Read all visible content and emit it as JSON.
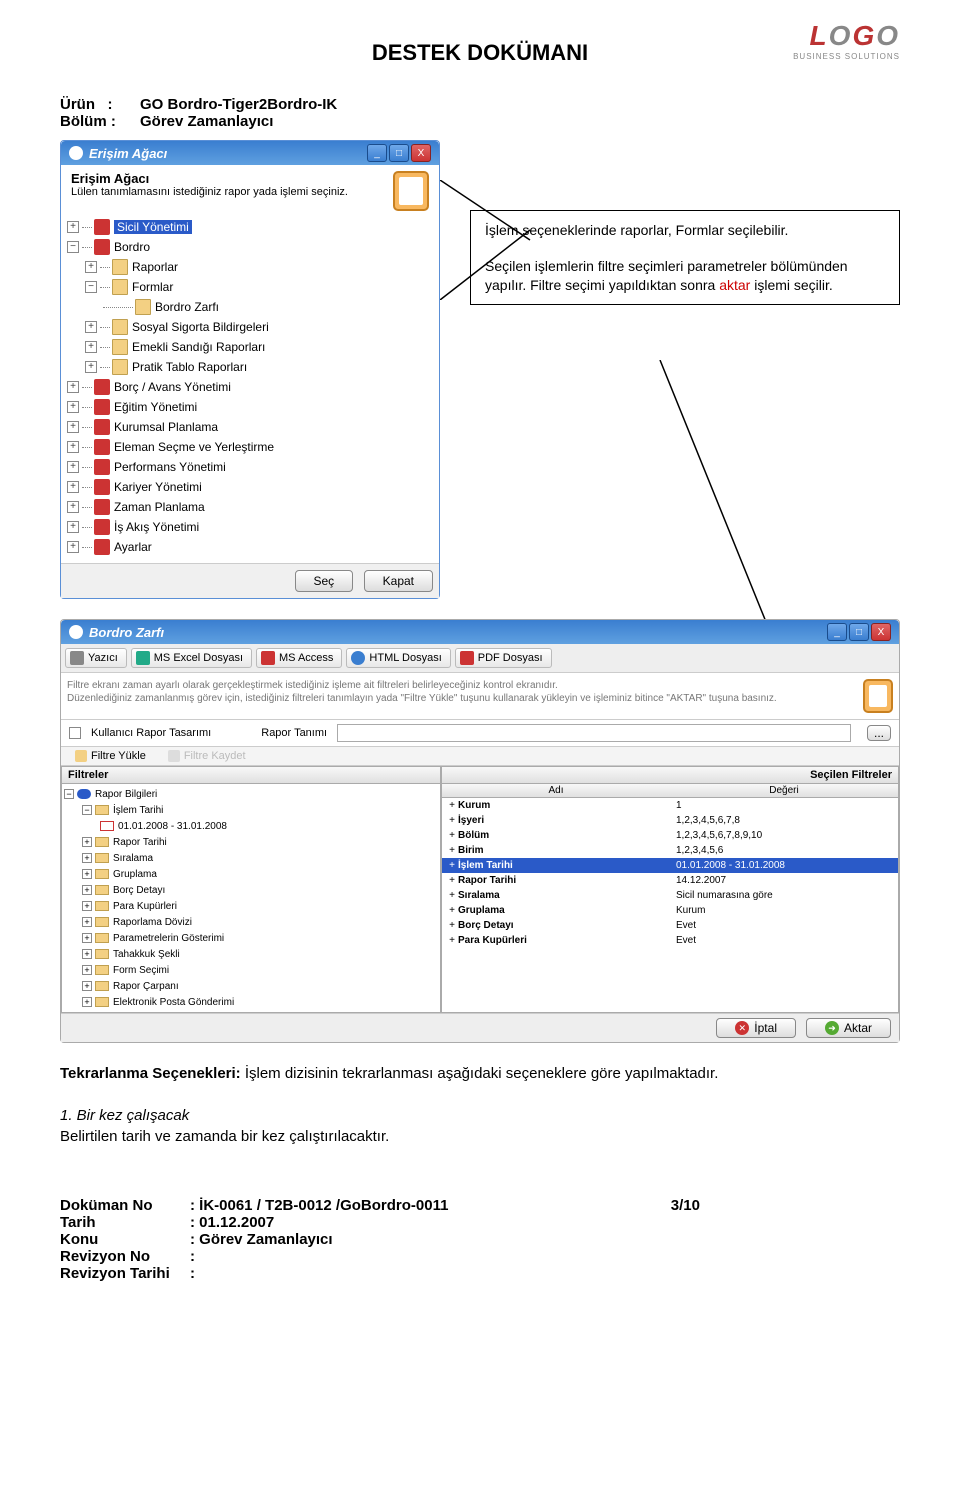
{
  "logo": {
    "brand": "LOGO",
    "sub": "BUSINESS SOLUTIONS"
  },
  "doc_title": "DESTEK DOKÜMANI",
  "meta": {
    "urun_label": "Ürün",
    "urun_value": "GO Bordro-Tiger2Bordro-IK",
    "bolum_label": "Bölüm",
    "bolum_value": "Görev Zamanlayıcı",
    "sep": ":"
  },
  "tree_window": {
    "title": "Erişim Ağacı",
    "header": "Erişim Ağacı",
    "subheader": "Lülen tanımlamasını istediğiniz rapor yada işlemi seçiniz.",
    "btn_sec": "Seç",
    "btn_kapat": "Kapat",
    "nodes": {
      "sicil": "Sicil Yönetimi",
      "bordro": "Bordro",
      "raporlar": "Raporlar",
      "formlar": "Formlar",
      "bordrozarfi": "Bordro Zarfı",
      "sosyal": "Sosyal Sigorta Bildirgeleri",
      "emekli": "Emekli Sandığı Raporları",
      "pratik": "Pratik Tablo Raporları",
      "borc": "Borç / Avans Yönetimi",
      "egitim": "Eğitim Yönetimi",
      "kurumsal": "Kurumsal Planlama",
      "eleman": "Eleman Seçme ve Yerleştirme",
      "perf": "Performans Yönetimi",
      "kariyer": "Kariyer Yönetimi",
      "zaman": "Zaman Planlama",
      "isakis": "İş Akış Yönetimi",
      "ayarlar": "Ayarlar"
    }
  },
  "callout": {
    "line1": "İşlem seçeneklerinde raporlar, Formlar seçilebilir.",
    "line2a": "Seçilen işlemlerin filtre seçimleri parametreler bölümünden yapılır. Filtre seçimi yapıldıktan sonra ",
    "line2_red": "aktar",
    "line2b": " işlemi seçilir."
  },
  "win2": {
    "title": "Bordro Zarfı",
    "toolbar": {
      "yazici": "Yazıcı",
      "excel": "MS Excel Dosyası",
      "access": "MS Access",
      "html": "HTML Dosyası",
      "pdf": "PDF Dosyası"
    },
    "info": "Filtre ekranı zaman ayarlı olarak gerçekleştirmek istediğiniz işleme ait filtreleri belirleyeceğiniz kontrol ekranıdır.\nDüzenlediğiniz zamanlanmış görev için, istediğiniz filtreleri tanımlayın yada \"Filtre Yükle\" tuşunu kullanarak yükleyin ve işleminiz bitince \"AKTAR\" tuşuna basınız.",
    "form": {
      "chk_label": "Kullanıcı Rapor Tasarımı",
      "rapor_label": "Rapor Tanımı",
      "rapor_value": "",
      "dots": "..."
    },
    "tb3": {
      "yukle": "Filtre Yükle",
      "kaydet": "Filtre Kaydet"
    },
    "left": {
      "hdr": "Filtreler",
      "nodes": {
        "rapbilg": "Rapor Bilgileri",
        "islemtarih": "İşlem Tarihi",
        "tarih": "01.01.2008 - 31.01.2008",
        "raptarih": "Rapor Tarihi",
        "siralama": "Sıralama",
        "gruplama": "Gruplama",
        "borcdetay": "Borç Detayı",
        "parakup": "Para Kupürleri",
        "rapdoviz": "Raporlama Dövizi",
        "paramgost": "Parametrelerin Gösterimi",
        "tahakkuk": "Tahakkuk Şekli",
        "formsec": "Form Seçimi",
        "rapcarpan": "Rapor Çarpanı",
        "eposta": "Elektronik Posta Gönderimi"
      }
    },
    "right": {
      "hdr": "Seçilen Filtreler",
      "col_adi": "Adı",
      "col_deg": "Değeri",
      "rows": [
        {
          "n": "Kurum",
          "v": "1"
        },
        {
          "n": "İşyeri",
          "v": "1,2,3,4,5,6,7,8"
        },
        {
          "n": "Bölüm",
          "v": "1,2,3,4,5,6,7,8,9,10"
        },
        {
          "n": "Birim",
          "v": "1,2,3,4,5,6"
        },
        {
          "n": "İşlem Tarihi",
          "v": "01.01.2008 - 31.01.2008",
          "sel": true
        },
        {
          "n": "Rapor Tarihi",
          "v": "14.12.2007"
        },
        {
          "n": "Sıralama",
          "v": "Sicil numarasına göre"
        },
        {
          "n": "Gruplama",
          "v": "Kurum"
        },
        {
          "n": "Borç Detayı",
          "v": "Evet"
        },
        {
          "n": "Para Kupürleri",
          "v": "Evet"
        }
      ]
    },
    "footer": {
      "iptal": "İptal",
      "aktar": "Aktar"
    }
  },
  "body": {
    "section_label": "Tekrarlanma  Seçenekleri:",
    "section_text": " İşlem dizisinin tekrarlanması aşağıdaki seçeneklere göre yapılmaktadır.",
    "item1_title": "1. Bir kez çalışacak",
    "item1_text": "Belirtilen tarih ve zamanda bir kez çalıştırılacaktır."
  },
  "footer": {
    "dokno_l": "Doküman No",
    "dokno_v": ": İK-0061 / T2B-0012 /GoBordro-0011",
    "page": "3/10",
    "tarih_l": "Tarih",
    "tarih_v": ": 01.12.2007",
    "konu_l": "Konu",
    "konu_v": ": Görev Zamanlayıcı",
    "revno_l": "Revizyon No",
    "revno_v": ":",
    "revt_l": "Revizyon Tarihi",
    "revt_v": ":"
  }
}
